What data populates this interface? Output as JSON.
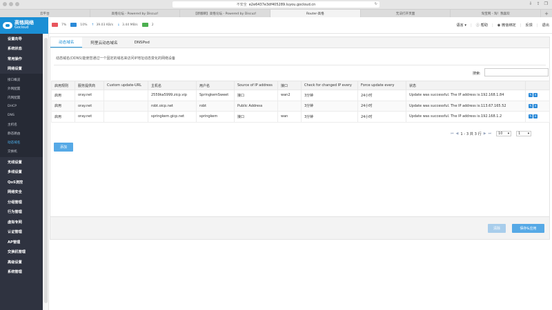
{
  "browser": {
    "url": "e2e6437e3df405289.luyou.gocloud.cn",
    "security": "不安全",
    "tabs": [
      {
        "label": "云平台",
        "active": false
      },
      {
        "label": "高恪论坛 - Powered by Discuz!",
        "active": false
      },
      {
        "label": "【新版瞬】高恪论坛 - Powered by Discuz!",
        "active": false
      },
      {
        "label": "Router-高恪",
        "active": true
      },
      {
        "label": "无法打开页面",
        "active": false
      },
      {
        "label": "淘宝网 - 淘！我喜欢",
        "active": false
      }
    ]
  },
  "header": {
    "logo_cn": "高恪网络",
    "logo_en": "Gocloud",
    "cpu": "7%",
    "mem": "10%",
    "up": "39.03 KB/s",
    "down": "3.44 MB/s",
    "online": "2",
    "colors": {
      "cpu": "#e8555d",
      "mem": "#2b8ad8",
      "online": "#4caf50",
      "brand": "#1b8fd5"
    },
    "right": {
      "language": "语言",
      "help": "帮助",
      "wechat": "微信绑定",
      "feedback": "反馈",
      "logout": "退出"
    }
  },
  "sidebar": {
    "top_items": [
      "设置向导",
      "系统状态",
      "常用操作",
      "网络设置"
    ],
    "sub_items": [
      {
        "label": "接口概览",
        "active": false
      },
      {
        "label": "外网配置",
        "active": false
      },
      {
        "label": "内网配置",
        "active": false
      },
      {
        "label": "DHCP",
        "active": false
      },
      {
        "label": "DNS",
        "active": false
      },
      {
        "label": "主机名",
        "active": false
      },
      {
        "label": "静态路由",
        "active": false
      },
      {
        "label": "动态域名",
        "active": true
      },
      {
        "label": "交换机",
        "active": false
      }
    ],
    "bottom_items": [
      "无线设置",
      "多线设置",
      "QoS流控",
      "网络安全",
      "分组管理",
      "行为管理",
      "虚拟专网",
      "认证管理",
      "AP管理",
      "交换机管理",
      "高级设置",
      "系统管理"
    ]
  },
  "main": {
    "tabs": [
      {
        "label": "动态域名",
        "active": true
      },
      {
        "label": "阿里云动态域名",
        "active": false
      },
      {
        "label": "DNSPod",
        "active": false
      }
    ],
    "description": "动态域名(DDNS)能使您通过一个固定的域名来访问IP地址动态变化的网络设备",
    "search_label": "搜索:",
    "search_value": "",
    "columns": [
      "启用规则",
      "服务提供商",
      "Custom update-URL",
      "主机名",
      "用户名",
      "Source of IP address",
      "接口",
      "Check for changed IP every",
      "Force update every",
      "状态",
      ""
    ],
    "rows": [
      {
        "enabled": "启用",
        "provider": "oray.net",
        "custom_url": "",
        "hostname": "2559ka5999.zicp.vip",
        "username": "SpringkemSweet",
        "source": "接口",
        "iface": "wan2",
        "check": "3分钟",
        "force": "24小时",
        "status": "Update was successful. The IP address is:192.168.1.84"
      },
      {
        "enabled": "启用",
        "provider": "oray.net",
        "custom_url": "",
        "hostname": "robt.oicp.net",
        "username": "robt",
        "source": "Public Address",
        "iface": "",
        "check": "3分钟",
        "force": "24小时",
        "status": "Update was successful. The IP address is:113.67.165.52"
      },
      {
        "enabled": "启用",
        "provider": "oray.net",
        "custom_url": "",
        "hostname": "springkem.gicp.net",
        "username": "springkem",
        "source": "接口",
        "iface": "wan",
        "check": "3分钟",
        "force": "24小时",
        "status": "Update was successful. The IP address is:192.168.1.2"
      }
    ],
    "pager": {
      "summary": "1 - 3 共 3 行",
      "page_size": "10",
      "page": "1"
    },
    "add_label": "添加",
    "clear_label": "清除",
    "save_label": "保存&应用"
  }
}
